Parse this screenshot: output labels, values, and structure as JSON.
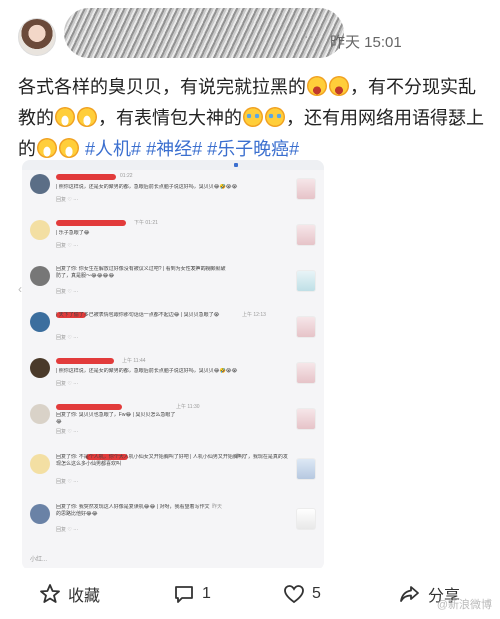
{
  "header": {
    "dots": "···",
    "timestamp": "昨天 15:01"
  },
  "post": {
    "text_1": "各式各样的臭贝贝，有说完就拉黑的",
    "text_2": "，有不分现实乱教的",
    "text_3": "，有表情包大神的",
    "text_4": "，还有用网络用语得瑟上的",
    "hashtags": [
      "#人机#",
      "#神经#",
      "#乐子晚癌#"
    ]
  },
  "comments": [
    {
      "time": "01:22",
      "text": "| 照你这样说，还是女的聚男的都，急眼后前长点脑子说这好吗，臭贝贝😂🤣😭😭",
      "actions": "回复  ♡  ···"
    },
    {
      "time": "下午 01:21",
      "text": "| 乐子急眼了😂",
      "actions": "回复  ♡  ···"
    },
    {
      "time": "下午 12:42",
      "text": "回复了你: 你女生在解放过好像没有被议义过吧? | 看到为女性发声的视频就破防了，真是服～😂😂😂😂",
      "actions": "回复  ♡  ···"
    },
    {
      "time": "上午 12:13",
      "text": "| 天下了偷了多已被表情包跟你那句话话一点都不起边😂 | 臭贝贝急眼了😭",
      "actions": "回复  ♡  ···"
    },
    {
      "time": "上午 11:44",
      "text": "| 照你这样说，还是女的聚男的都，急眼后前长点脑子说这好吗，臭贝贝😂🤣😭😭",
      "actions": "回复  ♡  ···"
    },
    {
      "time": "上午 11:30",
      "text": "回复了你: 臭贝贝也急眼了，Fw😂 | 臭贝贝怎么急眼了😂",
      "actions": "回复  ♡  ···"
    },
    {
      "time": "昨天",
      "text": "回复了你: 不是个人机，你个大人机小仙女又开始胸叫了好吧 | 人机小仙男又开始胸叫了，我现在是真的发现怎么这么多小仙男都喜欢叫",
      "actions": "回复  ♡  ···"
    },
    {
      "time": "昨天",
      "text": "回复了你: 我突然发现这人好像是复读机😂😂 | 对呀，我看望着写作文的思路比他好😂😂",
      "actions": "回复  ♡  ···"
    }
  ],
  "card": {
    "bottom_label": "小红..."
  },
  "bottom_bar": {
    "favorite_label": "收藏",
    "comment_count": "1",
    "like_count": "5",
    "share_label": "分享",
    "watermark": "@新浪微博"
  },
  "colors": {
    "hashtag": "#3b6fcf",
    "name_redaction": "#e23b3b"
  }
}
